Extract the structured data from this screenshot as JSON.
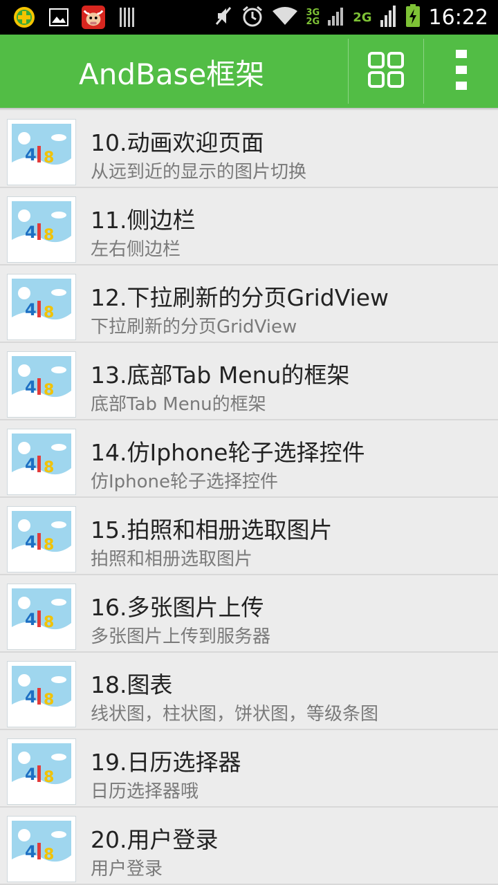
{
  "status_bar": {
    "time": "16:22",
    "net_top": "3G",
    "net_bottom": "2G",
    "net2": "2G",
    "icons": [
      "plus-circle-icon",
      "image-icon",
      "app-ox-icon",
      "barcode-icon",
      "mute-icon",
      "alarm-icon",
      "wifi-icon",
      "signal-icon",
      "battery-charging-icon"
    ]
  },
  "action_bar": {
    "title": "AndBase框架",
    "grid_icon": "grid-icon",
    "overflow_icon": "overflow-menu-icon",
    "color": "#52bd45"
  },
  "list": {
    "items": [
      {
        "title": "10.动画欢迎页面",
        "subtitle": "从远到近的显示的图片切换"
      },
      {
        "title": "11.侧边栏",
        "subtitle": "左右侧边栏"
      },
      {
        "title": "12.下拉刷新的分页GridView",
        "subtitle": "下拉刷新的分页GridView"
      },
      {
        "title": "13.底部Tab Menu的框架",
        "subtitle": "底部Tab Menu的框架"
      },
      {
        "title": "14.仿Iphone轮子选择控件",
        "subtitle": "仿Iphone轮子选择控件"
      },
      {
        "title": "15.拍照和相册选取图片",
        "subtitle": "拍照和相册选取图片"
      },
      {
        "title": "16.多张图片上传",
        "subtitle": "多张图片上传到服务器"
      },
      {
        "title": "18.图表",
        "subtitle": "线状图，柱状图，饼状图，等级条图"
      },
      {
        "title": "19.日历选择器",
        "subtitle": "日历选择器哦"
      },
      {
        "title": "20.用户登录",
        "subtitle": "用户登录"
      }
    ],
    "thumb_icon": "image-placeholder-icon"
  }
}
